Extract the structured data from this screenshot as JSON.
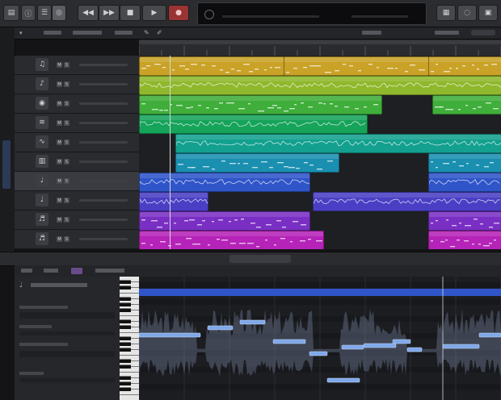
{
  "control_bar": {
    "buttons": [
      {
        "name": "library-button",
        "icon": "library-icon",
        "glyph": "▤"
      },
      {
        "name": "inspector-button",
        "icon": "info-icon",
        "glyph": "ⓘ"
      },
      {
        "name": "toolbar-button",
        "icon": "toolbar-icon",
        "glyph": "☰"
      },
      {
        "name": "smart-controls-button",
        "icon": "smart-controls-icon",
        "glyph": "◎"
      },
      {
        "name": "rewind-button",
        "icon": "rewind-icon",
        "glyph": "◀◀"
      },
      {
        "name": "forward-button",
        "icon": "forward-icon",
        "glyph": "▶▶"
      },
      {
        "name": "stop-button",
        "icon": "stop-icon",
        "glyph": "■"
      },
      {
        "name": "play-button",
        "icon": "play-icon",
        "glyph": "▶"
      },
      {
        "name": "record-button",
        "icon": "record-icon",
        "glyph": "●"
      }
    ],
    "right_buttons": [
      {
        "name": "notepad-button",
        "icon": "notepad-icon",
        "glyph": "▦"
      },
      {
        "name": "loops-button",
        "icon": "loops-icon",
        "glyph": "◌"
      }
    ],
    "lcd": {
      "position": "",
      "tempo": "",
      "signature": ""
    }
  },
  "colors": {
    "yellow": "#c9a227",
    "lime": "#8fb82c",
    "green": "#3fae3a",
    "emerald": "#16a35a",
    "teal": "#13a08f",
    "cyan": "#1a8fb0",
    "blue": "#2f55c9",
    "indigo": "#4a3fc4",
    "purple": "#7a2fc4",
    "magenta": "#b523b8",
    "playhead": "#d8d8d8"
  },
  "tracks": [
    {
      "number": "",
      "icon": "drum-machine-icon",
      "glyph": "♫",
      "name": "",
      "selected": false
    },
    {
      "number": "",
      "icon": "percussion-icon",
      "glyph": "♪",
      "name": "",
      "selected": false
    },
    {
      "number": "",
      "icon": "drum-kit-icon",
      "glyph": "◉",
      "name": "",
      "selected": false
    },
    {
      "number": "",
      "icon": "synth-icon",
      "glyph": "≋",
      "name": "",
      "selected": false
    },
    {
      "number": "",
      "icon": "audio-icon",
      "glyph": "∿",
      "name": "",
      "selected": false
    },
    {
      "number": "",
      "icon": "keyboard-icon",
      "glyph": "▥",
      "name": "",
      "selected": false
    },
    {
      "number": "",
      "icon": "microphone-icon",
      "glyph": "♩",
      "name": "",
      "selected": true
    },
    {
      "number": "",
      "icon": "microphone-icon",
      "glyph": "♩",
      "name": "",
      "selected": false
    },
    {
      "number": "",
      "icon": "guitar-icon",
      "glyph": "♬",
      "name": "",
      "selected": false
    },
    {
      "number": "",
      "icon": "bass-icon",
      "glyph": "♬",
      "name": "",
      "selected": false
    }
  ],
  "regions": [
    {
      "track": 0,
      "start": 0.0,
      "end": 0.4,
      "color": "yellow",
      "name": "",
      "wave": "midi"
    },
    {
      "track": 0,
      "start": 0.4,
      "end": 0.8,
      "color": "yellow",
      "name": "",
      "wave": "midi"
    },
    {
      "track": 0,
      "start": 0.8,
      "end": 1.0,
      "color": "yellow",
      "name": "",
      "wave": "midi"
    },
    {
      "track": 1,
      "start": 0.0,
      "end": 1.0,
      "color": "lime",
      "name": "",
      "wave": "audio"
    },
    {
      "track": 2,
      "start": 0.0,
      "end": 0.67,
      "color": "green",
      "name": "",
      "wave": "midi"
    },
    {
      "track": 2,
      "start": 0.81,
      "end": 1.0,
      "color": "green",
      "name": "",
      "wave": "midi"
    },
    {
      "track": 3,
      "start": 0.0,
      "end": 0.63,
      "color": "emerald",
      "name": "",
      "wave": "audio"
    },
    {
      "track": 4,
      "start": 0.1,
      "end": 1.0,
      "color": "teal",
      "name": "",
      "wave": "audio"
    },
    {
      "track": 5,
      "start": 0.1,
      "end": 0.55,
      "color": "cyan",
      "name": "",
      "wave": "midi"
    },
    {
      "track": 5,
      "start": 0.8,
      "end": 1.0,
      "color": "cyan",
      "name": "",
      "wave": "midi"
    },
    {
      "track": 6,
      "start": 0.0,
      "end": 0.47,
      "color": "blue",
      "name": "",
      "wave": "audio"
    },
    {
      "track": 6,
      "start": 0.8,
      "end": 1.0,
      "color": "blue",
      "name": "",
      "wave": "audio"
    },
    {
      "track": 7,
      "start": 0.0,
      "end": 0.19,
      "color": "indigo",
      "name": "",
      "wave": "audio"
    },
    {
      "track": 7,
      "start": 0.48,
      "end": 1.0,
      "color": "indigo",
      "name": "",
      "wave": "audio"
    },
    {
      "track": 8,
      "start": 0.0,
      "end": 0.47,
      "color": "purple",
      "name": "",
      "wave": "midi"
    },
    {
      "track": 8,
      "start": 0.8,
      "end": 1.0,
      "color": "purple",
      "name": "",
      "wave": "midi"
    },
    {
      "track": 9,
      "start": 0.0,
      "end": 0.51,
      "color": "magenta",
      "name": "",
      "wave": "midi"
    },
    {
      "track": 9,
      "start": 0.8,
      "end": 1.0,
      "color": "magenta",
      "name": "",
      "wave": "midi"
    }
  ],
  "playhead_fraction": 0.085,
  "editor": {
    "region_color": "blue",
    "playhead_fraction": 0.84,
    "notes": [
      {
        "start": 0.0,
        "len": 0.17,
        "pitch": 0.35
      },
      {
        "start": 0.19,
        "len": 0.07,
        "pitch": 0.28
      },
      {
        "start": 0.28,
        "len": 0.07,
        "pitch": 0.22
      },
      {
        "start": 0.37,
        "len": 0.09,
        "pitch": 0.42
      },
      {
        "start": 0.47,
        "len": 0.05,
        "pitch": 0.55
      },
      {
        "start": 0.52,
        "len": 0.09,
        "pitch": 0.82
      },
      {
        "start": 0.56,
        "len": 0.06,
        "pitch": 0.48
      },
      {
        "start": 0.62,
        "len": 0.09,
        "pitch": 0.46
      },
      {
        "start": 0.7,
        "len": 0.05,
        "pitch": 0.42
      },
      {
        "start": 0.74,
        "len": 0.04,
        "pitch": 0.5
      },
      {
        "start": 0.84,
        "len": 0.1,
        "pitch": 0.47
      },
      {
        "start": 0.94,
        "len": 0.06,
        "pitch": 0.35
      }
    ]
  }
}
